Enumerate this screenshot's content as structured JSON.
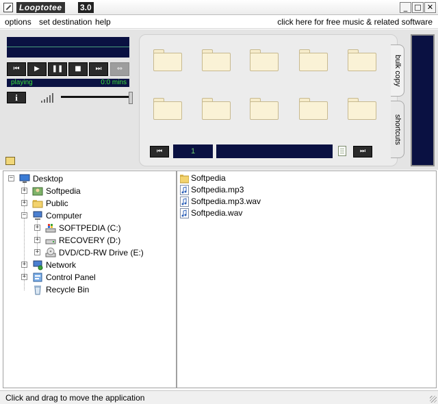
{
  "window": {
    "title": "Looptotee",
    "version": "3.0",
    "minimize": "_",
    "maximize": "□",
    "close": "✕"
  },
  "menu": {
    "items": [
      "options",
      "set destination",
      "help"
    ],
    "promo": "click here for free music & related software"
  },
  "player": {
    "status": "playing",
    "time": "0:0 mins",
    "buttons": {
      "prev": "⏮",
      "play": "▶",
      "pause": "❚❚",
      "stop": "■",
      "next": "⏭",
      "swap": "⇔"
    },
    "info": "i"
  },
  "shortcuts": {
    "page_number": "1",
    "prev": "⏮",
    "next": "⏭",
    "tabs": [
      "bulk copy",
      "shortcuts"
    ]
  },
  "tree": {
    "items": [
      {
        "label": "Desktop",
        "icon": "desktop-icon"
      },
      {
        "label": "Softpedia",
        "icon": "user-folder-icon"
      },
      {
        "label": "Public",
        "icon": "folder-icon"
      },
      {
        "label": "Computer",
        "icon": "computer-icon"
      },
      {
        "label": "SOFTPEDIA (C:)",
        "icon": "drive-c-icon"
      },
      {
        "label": "RECOVERY (D:)",
        "icon": "drive-icon"
      },
      {
        "label": "DVD/CD-RW Drive (E:)",
        "icon": "dvd-drive-icon"
      },
      {
        "label": "Network",
        "icon": "network-icon"
      },
      {
        "label": "Control Panel",
        "icon": "control-panel-icon"
      },
      {
        "label": "Recycle Bin",
        "icon": "recycle-bin-icon"
      }
    ]
  },
  "files": {
    "items": [
      {
        "label": "Softpedia",
        "icon": "folder-icon"
      },
      {
        "label": "Softpedia.mp3",
        "icon": "audio-file-icon"
      },
      {
        "label": "Softpedia.mp3.wav",
        "icon": "audio-file-icon"
      },
      {
        "label": "Softpedia.wav",
        "icon": "audio-file-icon"
      }
    ]
  },
  "statusbar": {
    "text": "Click and drag to move the application"
  }
}
